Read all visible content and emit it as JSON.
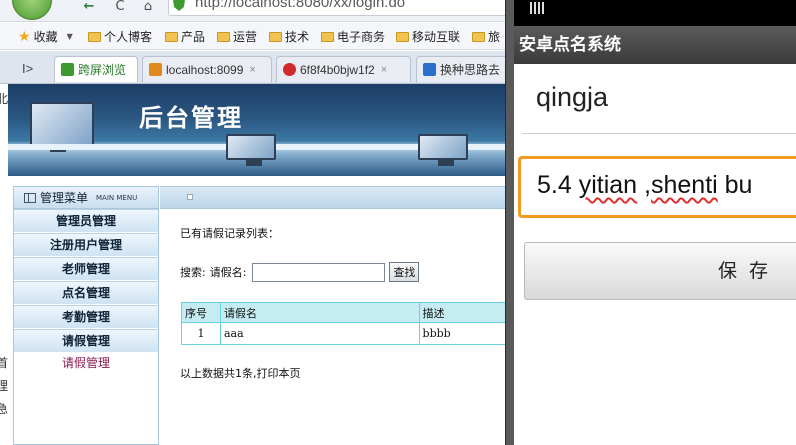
{
  "browser": {
    "nav": {
      "back": "←",
      "reload": "C",
      "home": "⌂"
    },
    "address": "http://localhost:8080/xx/login.do",
    "bookmarks": [
      {
        "label": "收藏"
      },
      {
        "label": "个人博客"
      },
      {
        "label": "产品"
      },
      {
        "label": "运营"
      },
      {
        "label": "技术"
      },
      {
        "label": "电子商务"
      },
      {
        "label": "移动互联"
      },
      {
        "label": "旅"
      }
    ],
    "tabs": [
      {
        "label": "跨屏浏览",
        "icon_color": "#3c9a2f"
      },
      {
        "label": "localhost:8099",
        "icon_color": "#e08a1e"
      },
      {
        "label": "6f8f4b0bjw1f2",
        "icon_color": "#d22a2a"
      },
      {
        "label": "换种思路去",
        "icon_color": "#2a6fc9"
      }
    ],
    "tab_close": "×",
    "side_chars": [
      "北",
      "首",
      "理",
      "急"
    ]
  },
  "admin": {
    "banner_title": "后台管理",
    "sidebar": {
      "title": "管理菜单",
      "subtitle": "MAIN MENU",
      "items": [
        "管理员管理",
        "注册用户管理",
        "老师管理",
        "点名管理",
        "考勤管理",
        "请假管理"
      ],
      "sub_item": "请假管理"
    },
    "content": {
      "list_title": "已有请假记录列表：",
      "search_label": "搜索:",
      "field_label": "请假名:",
      "search_value": "",
      "search_button": "查找",
      "table": {
        "headers": [
          "序号",
          "请假名",
          "描述"
        ],
        "rows": [
          [
            "1",
            "aaa",
            "bbbb"
          ]
        ]
      },
      "summary": "以上数据共1条,打印本页"
    }
  },
  "phone": {
    "app_title": "安卓点名系统",
    "name_value": "qingja",
    "desc_parts": [
      "5.4 ",
      "yitian",
      " ,",
      "shenti",
      " bu"
    ],
    "save_label": "保存"
  }
}
